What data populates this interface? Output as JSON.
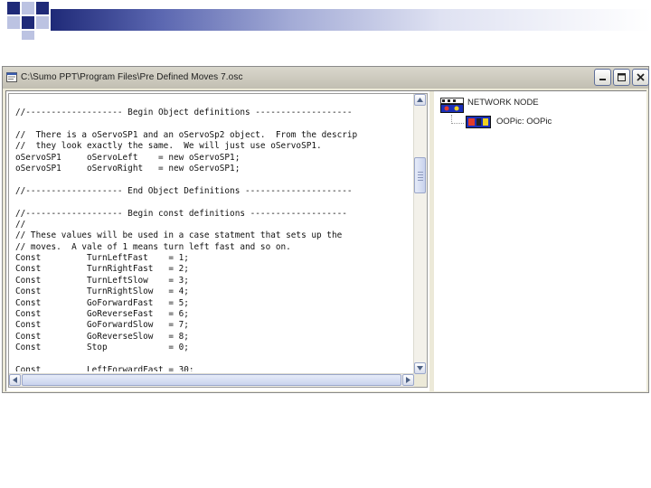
{
  "window": {
    "title": "C:\\Sumo PPT\\Program Files\\Pre Defined Moves 7.osc"
  },
  "editor": {
    "lines": [
      "//------------------- Begin Object definitions -------------------",
      "",
      "//  There is a oServoSP1 and an oServoSp2 object.  From the descrip",
      "//  they look exactly the same.  We will just use oServoSP1.",
      "oServoSP1     oServoLeft    = new oServoSP1;",
      "oServoSP1     oServoRight   = new oServoSP1;",
      "",
      "//------------------- End Object Definitions ---------------------",
      "",
      "//------------------- Begin const definitions -------------------",
      "//",
      "// These values will be used in a case statment that sets up the",
      "// moves.  A vale of 1 means turn left fast and so on.",
      "Const         TurnLeftFast    = 1;",
      "Const         TurnRightFast   = 2;",
      "Const         TurnLeftSlow    = 3;",
      "Const         TurnRightSlow   = 4;",
      "Const         GoForwardFast   = 5;",
      "Const         GoReverseFast   = 6;",
      "Const         GoForwardSlow   = 7;",
      "Const         GoReverseSlow   = 8;",
      "Const         Stop            = 0;",
      "",
      "Const         LeftForwardFast = 30;"
    ]
  },
  "tree": {
    "root_label": "NETWORK NODE",
    "child_label": "OOPic: OOPic"
  }
}
